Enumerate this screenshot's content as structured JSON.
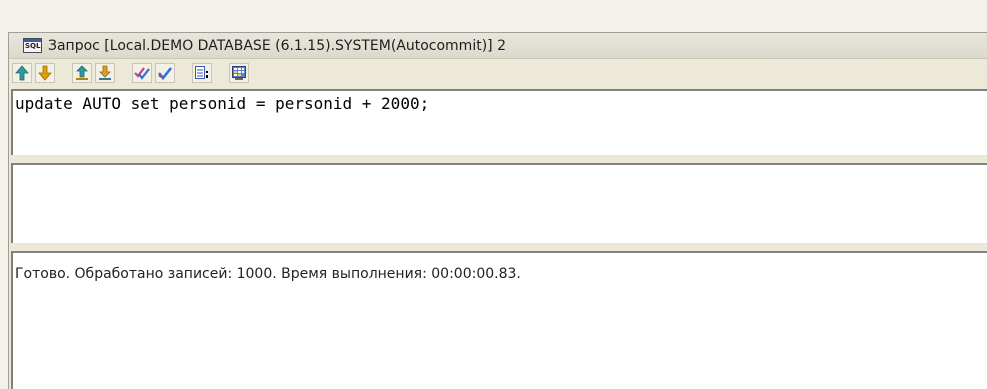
{
  "window": {
    "title": "Запрос [Local.DEMO DATABASE (6.1.15).SYSTEM(Autocommit)] 2",
    "icon_text": "SQL"
  },
  "toolbar": {
    "buttons": [
      {
        "name": "first-record-up",
        "icon": "arrow-up-teal"
      },
      {
        "name": "next-record-down",
        "icon": "arrow-down-orange"
      },
      {
        "name": "prev-query",
        "icon": "arrow-up-underline"
      },
      {
        "name": "next-query",
        "icon": "arrow-down-underline"
      },
      {
        "name": "commit",
        "icon": "double-check-icon"
      },
      {
        "name": "execute",
        "icon": "check-icon"
      },
      {
        "name": "output-to-file",
        "icon": "document-icon"
      },
      {
        "name": "explain-plan",
        "icon": "grid-computer-icon"
      }
    ]
  },
  "editor": {
    "text": "update AUTO set personid = personid + 2000;"
  },
  "status": {
    "message": "Готово. Обработано записей: 1000. Время выполнения: 00:00:00.83."
  }
}
